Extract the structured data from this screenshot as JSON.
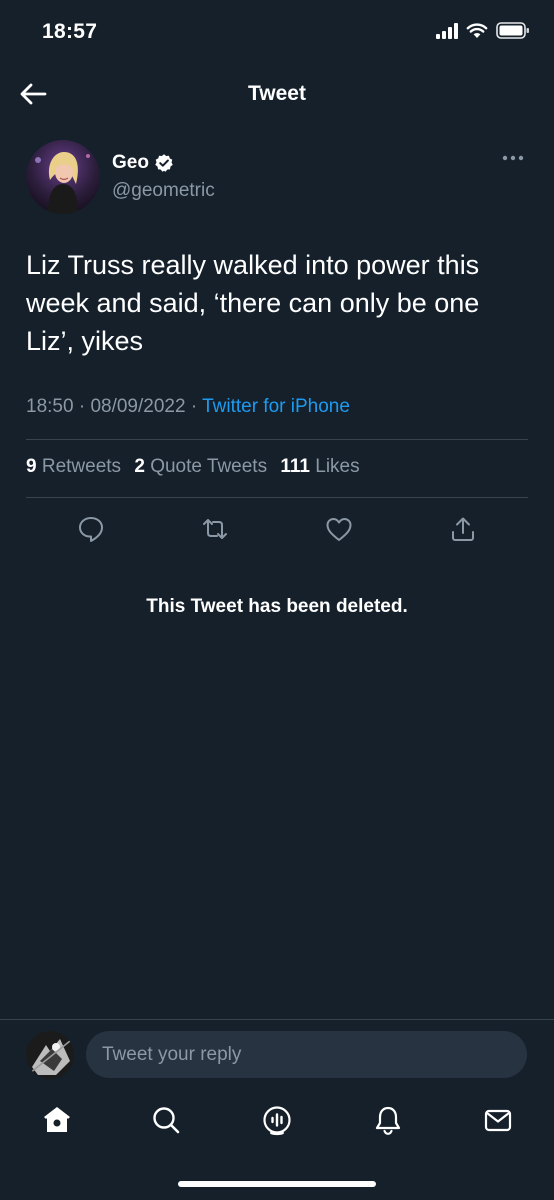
{
  "status_bar": {
    "time": "18:57",
    "icons": [
      "signal-icon",
      "wifi-icon",
      "battery-icon"
    ]
  },
  "header": {
    "title": "Tweet",
    "back_icon": "back-arrow-icon"
  },
  "tweet": {
    "author": {
      "display_name": "Geo",
      "verified": true,
      "handle": "@geometric"
    },
    "text": "Liz Truss really walked into power this week and said, ‘there can only be one Liz’, yikes",
    "time": "18:50",
    "date": "08/09/2022",
    "separator": "·",
    "source": "Twitter for iPhone",
    "stats": {
      "retweets_count": "9",
      "retweets_label": "Retweets",
      "quotes_count": "2",
      "quotes_label": "Quote Tweets",
      "likes_count": "111",
      "likes_label": "Likes"
    },
    "actions": [
      "reply-icon",
      "retweet-icon",
      "like-icon",
      "share-icon"
    ]
  },
  "deleted_notice": "This Tweet has been deleted.",
  "reply": {
    "placeholder": "Tweet your reply"
  },
  "tab_bar": [
    "home-icon",
    "search-icon",
    "spaces-icon",
    "notifications-icon",
    "messages-icon"
  ],
  "colors": {
    "background": "#15202b",
    "accent": "#1d9bf0",
    "secondary_text": "#8b98a5",
    "divider": "#38444d"
  }
}
